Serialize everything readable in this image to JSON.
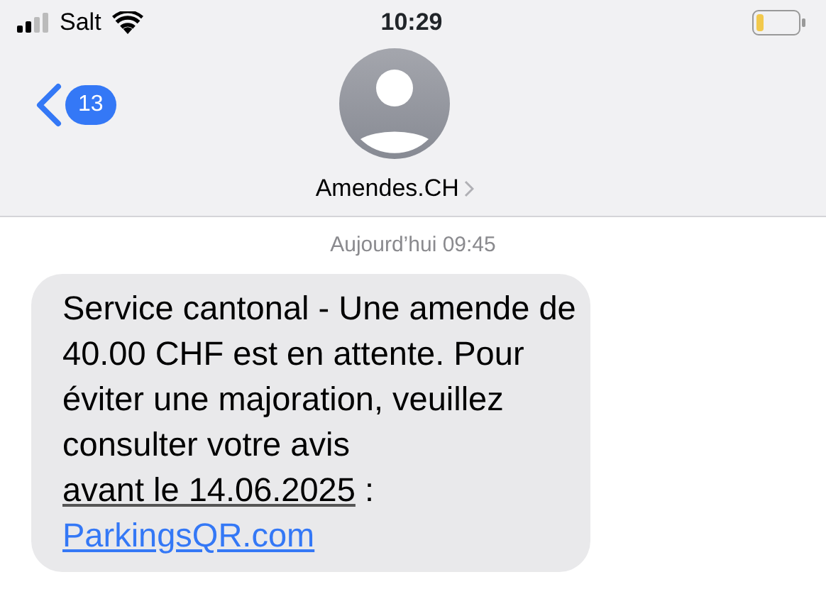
{
  "status_bar": {
    "carrier": "Salt",
    "time": "10:29"
  },
  "header": {
    "back_badge": "13",
    "contact_name": "Amendes.CH"
  },
  "timestamp": "Aujourd’hui 09:45",
  "message": {
    "parts": [
      {
        "kind": "text",
        "text": "Service cantonal - Une amende de 40.00 CHF est en attente. Pour éviter une majoration, veuillez consulter votre avis "
      },
      {
        "kind": "date",
        "text": "avant le 14.06.2025"
      },
      {
        "kind": "text",
        "text": " :"
      },
      {
        "kind": "link",
        "text": "ParkingsQR.com"
      }
    ]
  }
}
